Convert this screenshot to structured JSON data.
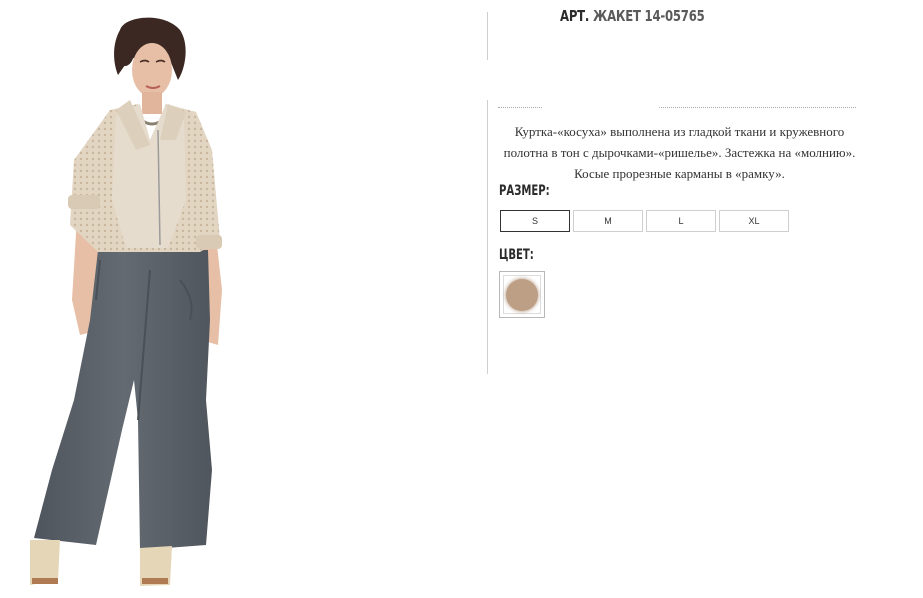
{
  "product": {
    "title_prefix": "АРТ.",
    "title_name": "ЖАКЕТ 14-05765",
    "description": "Куртка-«косуха» выполнена из гладкой ткани и кружевного полотна в тон с дырочками-«ришелье». Застежка на «молнию». Косые прорезные карманы в «рамку»."
  },
  "size_section": {
    "label": "РАЗМЕР:",
    "options": [
      "S",
      "M",
      "L",
      "XL"
    ],
    "selected": "S"
  },
  "color_section": {
    "label": "ЦВЕТ:",
    "swatches": [
      {
        "name": "beige-swatch",
        "color": "#bd9f86",
        "selected": true
      }
    ]
  },
  "colors": {
    "jacket": "#e4d8c6",
    "trousers": "#5b6168",
    "skin": "#e7bfa6",
    "hair": "#3b2822",
    "sandals": "#e6d6b8"
  }
}
